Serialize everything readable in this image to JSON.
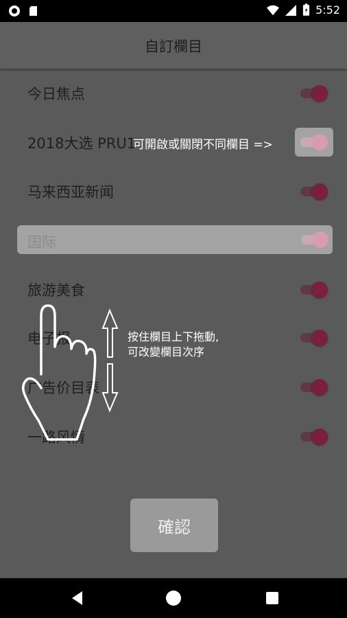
{
  "status_bar": {
    "time": "5:52"
  },
  "title": "自訂欄目",
  "channels": [
    {
      "label": "今日焦点",
      "enabled": true
    },
    {
      "label": "2018大选 PRU14",
      "enabled": true
    },
    {
      "label": "马来西亚新闻",
      "enabled": true
    },
    {
      "label": "国际",
      "enabled": true
    },
    {
      "label": "旅游美食",
      "enabled": true
    },
    {
      "label": "电子报",
      "enabled": true
    },
    {
      "label": "广告价目表",
      "enabled": true
    },
    {
      "label": "一路风情",
      "enabled": true
    }
  ],
  "tips": {
    "toggle_tip": "可開啟或關閉不同欄目 =>",
    "drag_tip_line1": "按住欄目上下拖動,",
    "drag_tip_line2": "可改變欄目次序"
  },
  "confirm_label": "確認",
  "colors": {
    "overlay_bg": "#5a5a5a",
    "toggle_thumb": "#7a1f3f",
    "highlight": "#a3a3a3"
  },
  "icons": [
    "notification-dot-icon",
    "sd-card-icon",
    "wifi-icon",
    "signal-icon",
    "battery-icon",
    "back-icon",
    "home-icon",
    "recents-icon",
    "hand-pointer-icon",
    "up-arrow-icon",
    "down-arrow-icon"
  ]
}
